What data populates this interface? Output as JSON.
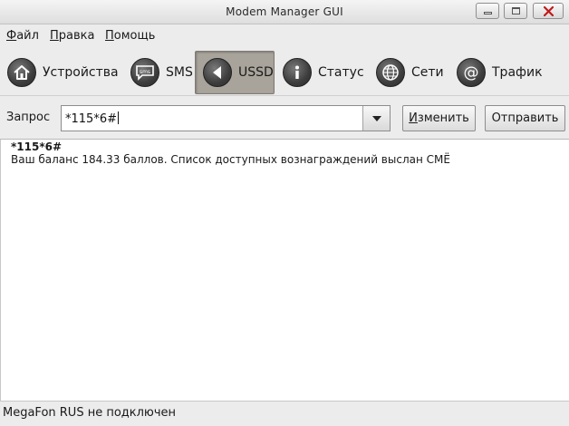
{
  "window": {
    "title": "Modem Manager GUI"
  },
  "menu": {
    "items": [
      {
        "label": "Файл"
      },
      {
        "label": "Правка"
      },
      {
        "label": "Помощь"
      }
    ]
  },
  "toolbar": {
    "buttons": [
      {
        "label": "Устройства",
        "icon": "home-icon"
      },
      {
        "label": "SMS",
        "icon": "sms-icon"
      },
      {
        "label": "USSD",
        "icon": "speaker-icon",
        "active": true
      },
      {
        "label": "Статус",
        "icon": "info-icon"
      },
      {
        "label": "Сети",
        "icon": "globe-icon"
      },
      {
        "label": "Трафик",
        "icon": "at-icon"
      }
    ]
  },
  "query": {
    "label": "Запрос",
    "value": "*115*6#",
    "change_label": "Изменить",
    "send_label": "Отправить"
  },
  "output": {
    "command": "*115*6#",
    "response": "Ваш баланс 184.33 баллов. Список доступных вознаграждений выслан СМЁ"
  },
  "status": {
    "text": "MegaFon RUS не подключен"
  },
  "colors": {
    "active_tab": "#a9a49b",
    "window_bg": "#ececec"
  }
}
